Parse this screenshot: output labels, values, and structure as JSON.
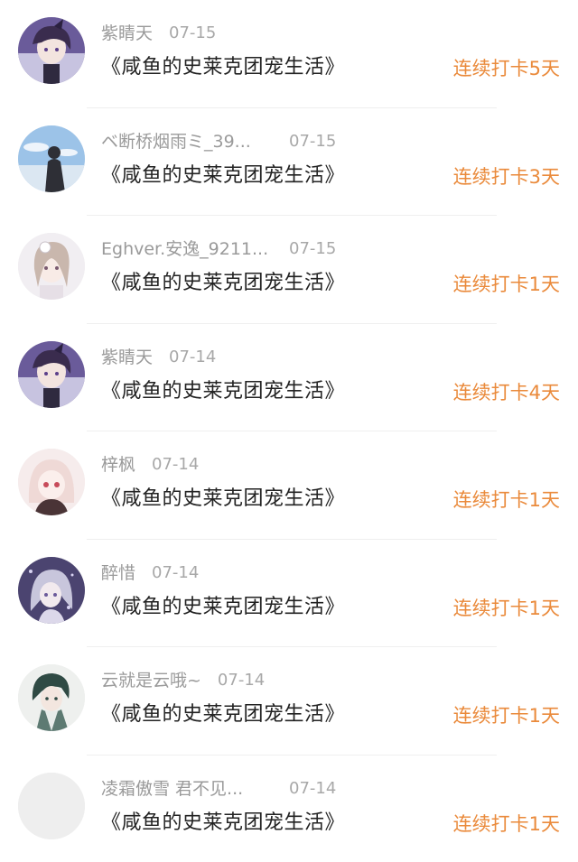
{
  "colors": {
    "streak": "#ea8a3b",
    "title": "#222222",
    "meta": "#9a9a9a"
  },
  "items": [
    {
      "user": "紫睛天",
      "date": "07-15",
      "book": "《咸鱼的史莱克团宠生活》",
      "streak": "连续打卡5天",
      "avatar": "anime-girl-purple-avatar"
    },
    {
      "user": "ベ断桥烟雨ミ_39...",
      "date": "07-15",
      "book": "《咸鱼的史莱克团宠生活》",
      "streak": "连续打卡3天",
      "avatar": "silhouette-sky-avatar"
    },
    {
      "user": "Eghver.安逸_9211...",
      "date": "07-15",
      "book": "《咸鱼的史莱克团宠生活》",
      "streak": "连续打卡1天",
      "avatar": "anime-girl-lace-avatar"
    },
    {
      "user": "紫睛天",
      "date": "07-14",
      "book": "《咸鱼的史莱克团宠生活》",
      "streak": "连续打卡4天",
      "avatar": "anime-girl-purple-avatar"
    },
    {
      "user": "梓枫",
      "date": "07-14",
      "book": "《咸鱼的史莱克团宠生活》",
      "streak": "连续打卡1天",
      "avatar": "anime-girl-pink-avatar"
    },
    {
      "user": "醉惜",
      "date": "07-14",
      "book": "《咸鱼的史莱克团宠生活》",
      "streak": "连续打卡1天",
      "avatar": "anime-girl-silver-avatar"
    },
    {
      "user": "云就是云哦~",
      "date": "07-14",
      "book": "《咸鱼的史莱克团宠生活》",
      "streak": "连续打卡1天",
      "avatar": "anime-boy-green-avatar"
    },
    {
      "user": "凌霜傲雪 君不见...",
      "date": "07-14",
      "book": "《咸鱼的史莱克团宠生活》",
      "streak": "连续打卡1天",
      "avatar": "default-gray-avatar"
    }
  ]
}
